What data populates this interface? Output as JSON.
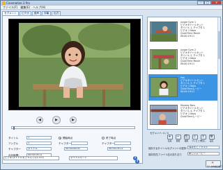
{
  "window": {
    "title": "Cinematize 3 Pro",
    "minimize": "–",
    "maximize": "□",
    "close": "✕"
  },
  "menu": [
    "ファイル(F)",
    "編集(E)",
    "ヘルプ(H)"
  ],
  "tabs": [
    "セグメント",
    "ビデオ",
    "音声",
    "字幕",
    "出力"
  ],
  "player": {
    "rewind": "◀",
    "play": "▶",
    "forward": "▶",
    "progress": 0.01
  },
  "segment_form": {
    "title_label": "タイトル",
    "title_value": "1",
    "angle_label": "アングル",
    "angle_value": "1",
    "chapter_label": "チャプター",
    "chapter_value": "タイトル",
    "total_time_label": "合計時間:",
    "total_time_value": "00:00:19:11",
    "start_label": "開始時点",
    "start_chapter_label": "チャプター",
    "start_time": "00:00:00:00",
    "end_label": "終了時点",
    "end_chapter_label": "チャプター",
    "end_time": "00:00:19:11",
    "help": "?"
  },
  "bottom_bar": {
    "left_select": "ビデオ(タイトルセット2)- (1/1-5:5)",
    "mode_select": "タイトルモード",
    "help": "?"
  },
  "clips": [
    {
      "name": "Jungle Gym 1",
      "lines": [
        "Jungle Gym 1",
        "ビデオタイトルセット",
        "タイトル 1, チャプタ 1",
        "ビデオ 1 Kbps",
        "QuickTime Movie",
        "00:00:19:11"
      ]
    },
    {
      "name": "Jungle Gym 2",
      "lines": [
        "Jungle Gym 2",
        "ビデオタイトルセット",
        "タイトル 2, チャプタ 1",
        "ビデオ 1 Kbps",
        "QuickTime Movie",
        "00:00:19:11"
      ]
    },
    {
      "name": "Hat",
      "lines": [
        "Hat",
        "ビデオタイトルセット",
        "タイトル 3, チャプタ 1",
        "ビデオ 1 Kbps",
        "QuickTimeムービー",
        "00:00:19:11"
      ]
    },
    {
      "name": "Monkey Bars",
      "lines": [
        "Monkey Bars",
        "ビデオタイトルセット",
        "タイトル 4, チャプタ 1",
        "ビデオ 1 Kbps",
        "QuickTimeムービー"
      ]
    }
  ],
  "selected_clip": 2,
  "segment_count": "セグメント: 4 / 4",
  "toolbar": [
    {
      "icon": "+",
      "label": "追加"
    },
    {
      "icon": "−",
      "label": "削除"
    },
    {
      "icon": "⎘",
      "label": "複製"
    },
    {
      "icon": "⌕",
      "label": "プレビュー"
    },
    {
      "icon": "⇪",
      "label": "書出し"
    },
    {
      "icon": "⚙",
      "label": "設定"
    }
  ],
  "right_form": {
    "label1": "保存するタイトル/セグメントの選択:",
    "value1": "保存先とフォルダ",
    "label2": "保存形式/ファイル名の割り当て:",
    "value2": "新しいムービー"
  },
  "close_button": "データ作成の終了"
}
